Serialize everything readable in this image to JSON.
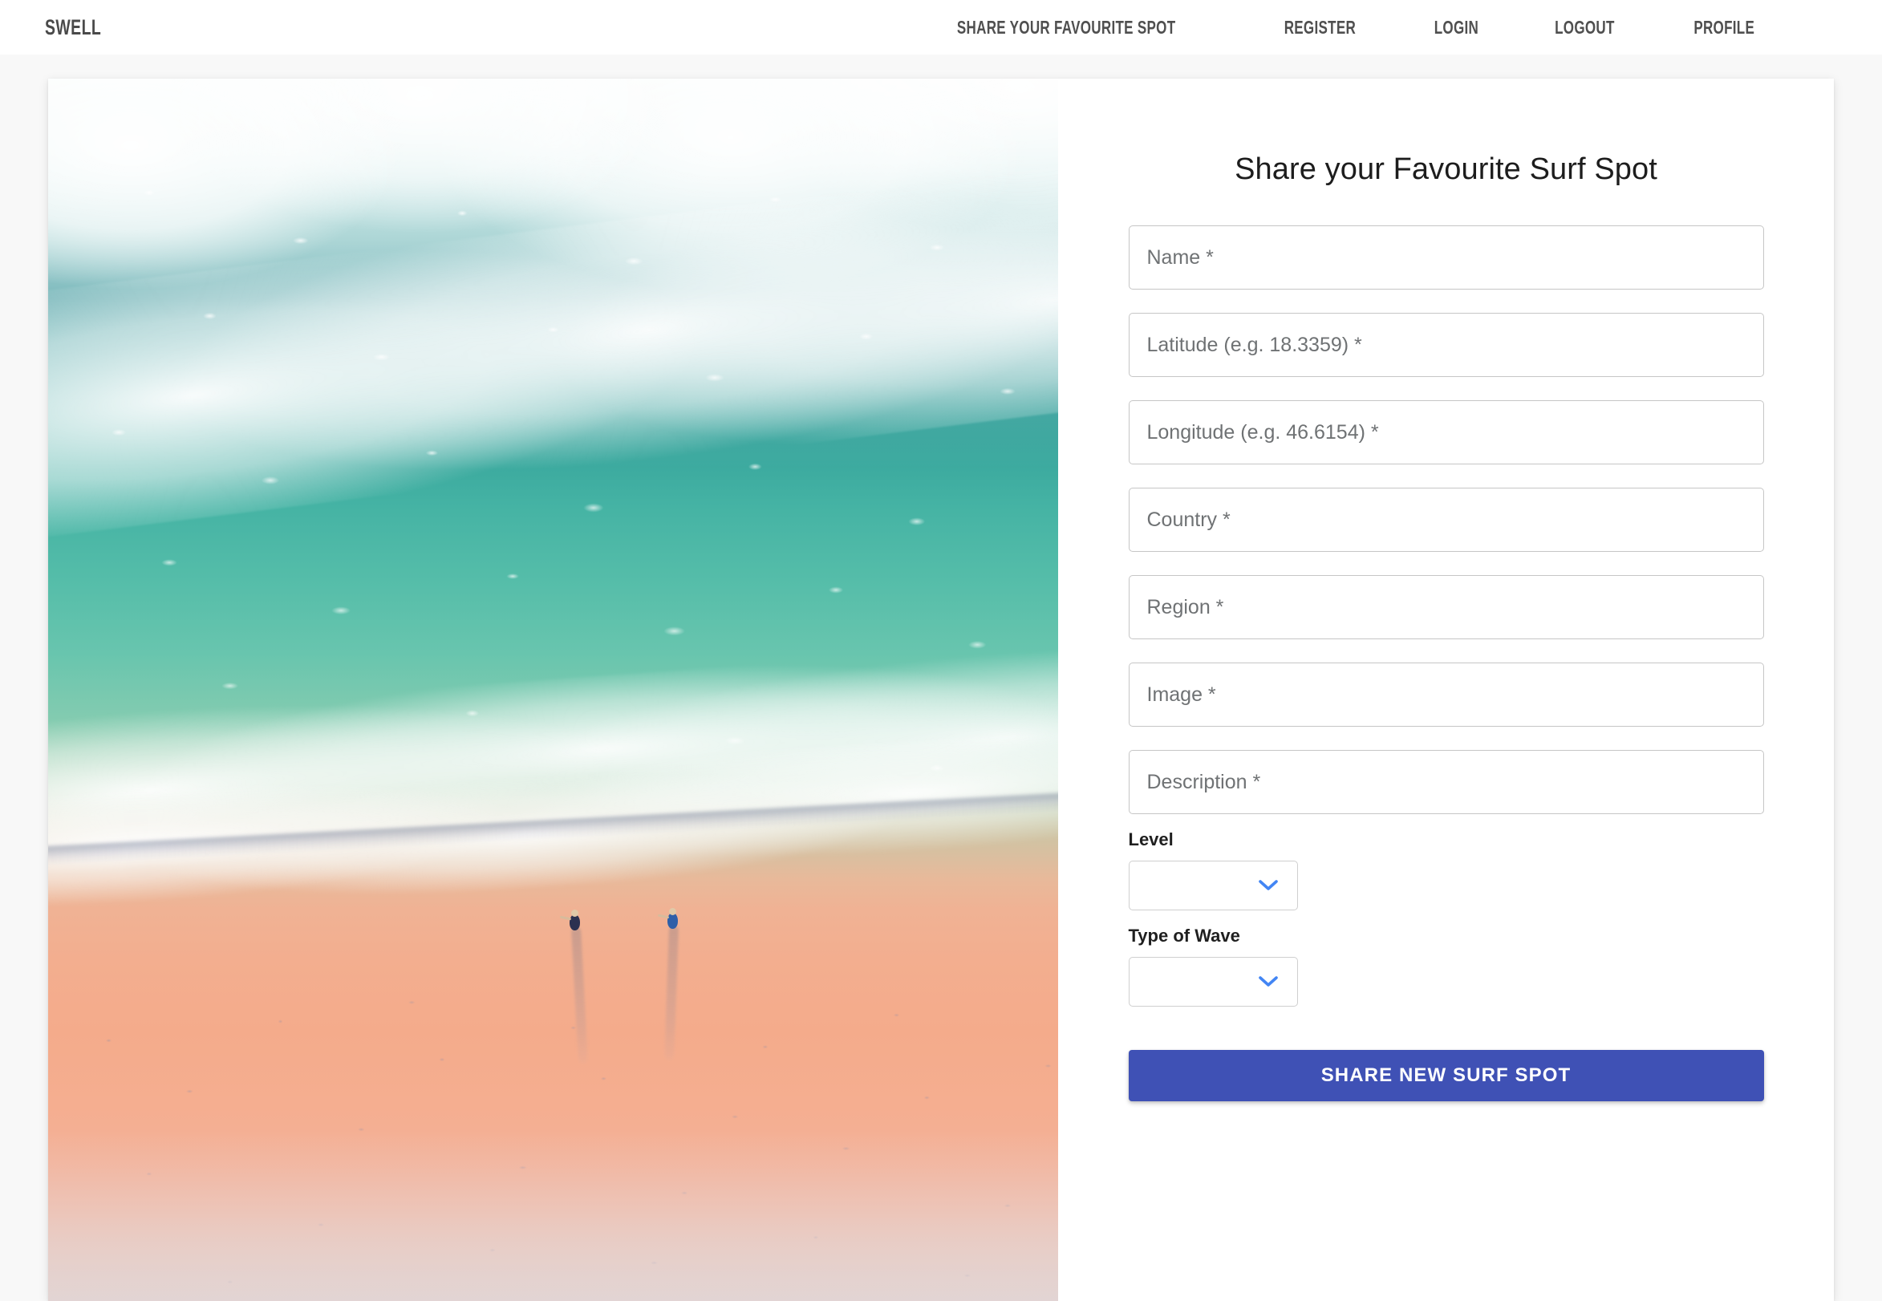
{
  "navbar": {
    "brand": "SWELL",
    "links": [
      {
        "label": "SHARE YOUR FAVOURITE SPOT",
        "name": "nav-link-share-spot"
      },
      {
        "label": "REGISTER",
        "name": "nav-link-register"
      },
      {
        "label": "LOGIN",
        "name": "nav-link-login"
      },
      {
        "label": "LOGOUT",
        "name": "nav-link-logout"
      },
      {
        "label": "PROFILE",
        "name": "nav-link-profile"
      }
    ]
  },
  "hero": {
    "alt": "Aerial photograph of turquoise ocean surf meeting peach sand beach with two people walking"
  },
  "form": {
    "title": "Share your Favourite Surf Spot",
    "fields": [
      {
        "name": "name-input",
        "placeholder": "Name *",
        "value": ""
      },
      {
        "name": "latitude-input",
        "placeholder": "Latitude (e.g. 18.3359) *",
        "value": ""
      },
      {
        "name": "longitude-input",
        "placeholder": "Longitude (e.g. 46.6154) *",
        "value": ""
      },
      {
        "name": "country-input",
        "placeholder": "Country *",
        "value": ""
      },
      {
        "name": "region-input",
        "placeholder": "Region *",
        "value": ""
      },
      {
        "name": "image-input",
        "placeholder": "Image *",
        "value": ""
      },
      {
        "name": "description-input",
        "placeholder": "Description *",
        "value": ""
      }
    ],
    "selects": [
      {
        "name": "level-select",
        "label": "Level",
        "value": ""
      },
      {
        "name": "wave-type-select",
        "label": "Type of Wave",
        "value": ""
      }
    ],
    "submit_label": "Share New Surf Spot"
  },
  "colors": {
    "accent": "#3f51b5",
    "chevron": "#4285f4",
    "page_background": "#f8f8f8",
    "field_border": "#c6c6c6",
    "nav_text": "#4f4f4f"
  }
}
